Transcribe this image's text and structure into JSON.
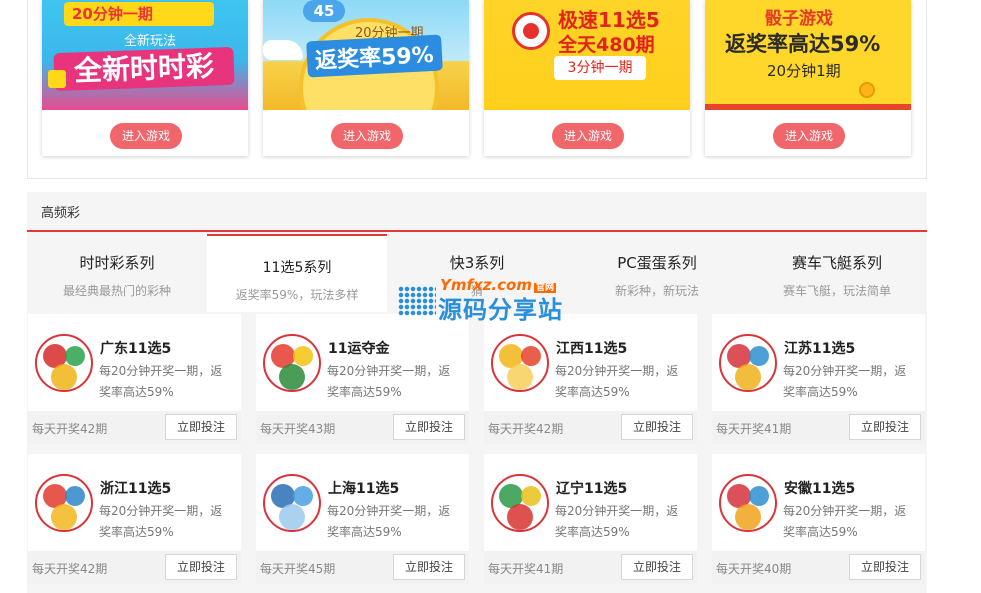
{
  "featured": {
    "enter_label": "进入游戏",
    "promos": [
      {
        "name": "时时彩",
        "line1": "20分钟一期",
        "line2": "全新玩法",
        "line3": "全新时时彩"
      },
      {
        "name": "45",
        "line1": "20分钟一期",
        "line2": "返奖率59%"
      },
      {
        "name": "极速11选5",
        "line1": "极速11选5",
        "line2": "全天480期",
        "line3": "3分钟一期"
      },
      {
        "name": "骰子游戏",
        "line1": "骰子游戏",
        "line2": "返奖率高达59%",
        "line3": "20分钟1期"
      }
    ]
  },
  "section": {
    "title": "高频彩",
    "tabs": [
      {
        "name": "时时彩系列",
        "desc": "最经典最热门的彩种"
      },
      {
        "name": "11选5系列",
        "desc": "返奖率59%，玩法多样"
      },
      {
        "name": "快3系列",
        "desc": "猜"
      },
      {
        "name": "PC蛋蛋系列",
        "desc": "新彩种，新玩法"
      },
      {
        "name": "赛车飞艇系列",
        "desc": "赛车飞艇，玩法简单"
      }
    ],
    "bet_label": "立即投注",
    "games": [
      {
        "name": "广东11选5",
        "desc": "每20分钟开奖一期，返奖率高达59%",
        "draws": "每天开奖42期",
        "colors": [
          "#d62a2a",
          "#2aa24a",
          "#f0b416"
        ]
      },
      {
        "name": "11运夺金",
        "desc": "每20分钟开奖一期，返奖率高达59%",
        "draws": "每天开奖43期",
        "colors": [
          "#e63b2e",
          "#f6c20f",
          "#2c8a3c"
        ]
      },
      {
        "name": "江西11选5",
        "desc": "每20分钟开奖一期，返奖率高达59%",
        "draws": "每天开奖42期",
        "colors": [
          "#f2b517",
          "#e5432b",
          "#f7d05a"
        ]
      },
      {
        "name": "江苏11选5",
        "desc": "每20分钟开奖一期，返奖率高达59%",
        "draws": "每天开奖41期",
        "colors": [
          "#d6323c",
          "#2e8fce",
          "#f0b21b"
        ]
      },
      {
        "name": "浙江11选5",
        "desc": "每20分钟开奖一期，返奖率高达59%",
        "draws": "每天开奖42期",
        "colors": [
          "#e23a2f",
          "#2f86c9",
          "#f3b71e"
        ]
      },
      {
        "name": "上海11选5",
        "desc": "每20分钟开奖一期，返奖率高达59%",
        "draws": "每天开奖45期",
        "colors": [
          "#2a6fb5",
          "#4aa0e0",
          "#9cc9ee"
        ]
      },
      {
        "name": "辽宁11选5",
        "desc": "每20分钟开奖一期，返奖率高达59%",
        "draws": "每天开奖41期",
        "colors": [
          "#2b9a48",
          "#e8c21a",
          "#d7322f"
        ]
      },
      {
        "name": "安徽11选5",
        "desc": "每20分钟开奖一期，返奖率高达59%",
        "draws": "每天开奖40期",
        "colors": [
          "#d6323c",
          "#2e8fce",
          "#f0a21b"
        ]
      }
    ]
  },
  "watermark": {
    "top": "Ymfxz.com",
    "badge": "官网",
    "main": "源码分享站"
  }
}
